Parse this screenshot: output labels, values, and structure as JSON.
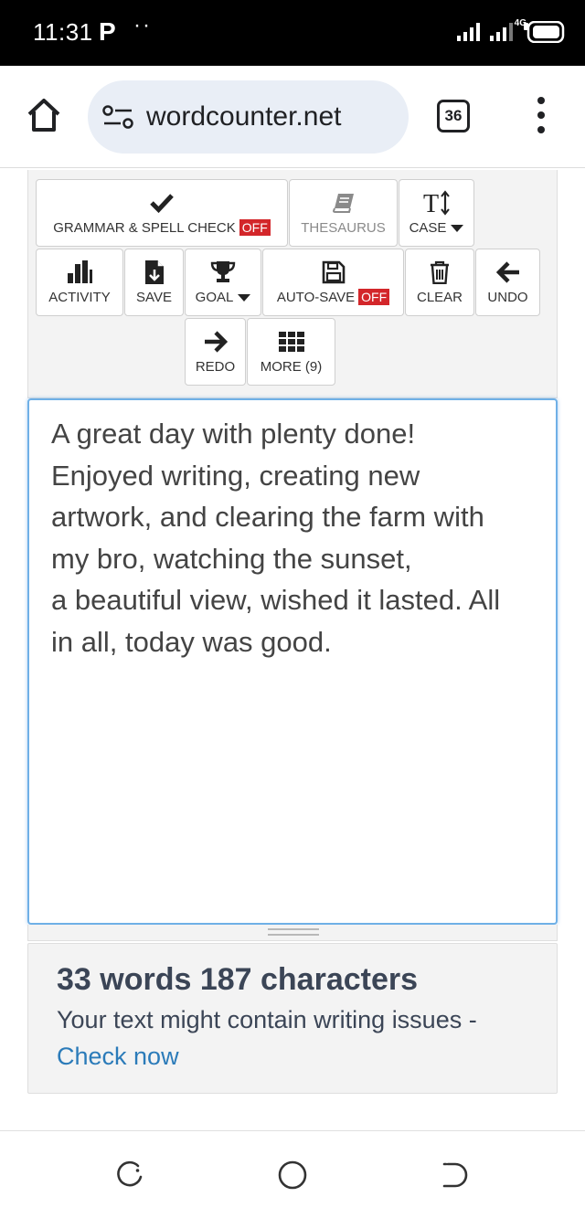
{
  "status_bar": {
    "time": "11:31",
    "notification_app": "P",
    "dots": "··",
    "network_type": "4G",
    "icons": [
      "signal-icon",
      "signal-4g-icon",
      "battery-icon"
    ]
  },
  "browser": {
    "url": "wordcounter.net",
    "tab_count": "36",
    "icons": [
      "home-icon",
      "site-settings-icon",
      "more-vert-icon"
    ]
  },
  "toolbar": {
    "grammar_label": "GRAMMAR & SPELL CHECK",
    "grammar_state": "OFF",
    "thesaurus_label": "THESAURUS",
    "case_label": "CASE",
    "activity_label": "ACTIVITY",
    "save_label": "SAVE",
    "goal_label": "GOAL",
    "autosave_label": "AUTO-SAVE",
    "autosave_state": "OFF",
    "clear_label": "CLEAR",
    "undo_label": "UNDO",
    "redo_label": "REDO",
    "more_label": "MORE (9)"
  },
  "editor": {
    "lines": [
      "A great day with plenty done!",
      "Enjoyed writing, creating new",
      "artwork, and clearing the farm with",
      "my bro, watching the sunset,",
      "a beautiful view, wished it lasted. All",
      "in all, today was good."
    ]
  },
  "stats": {
    "count_text": "33 words 187 characters",
    "message": "Your text might contain writing issues -",
    "link": "Check now"
  },
  "colors": {
    "off_badge": "#d3262a",
    "link": "#2b7bb9",
    "editor_border": "#6fb0e6",
    "stats_text": "#3b4556"
  }
}
